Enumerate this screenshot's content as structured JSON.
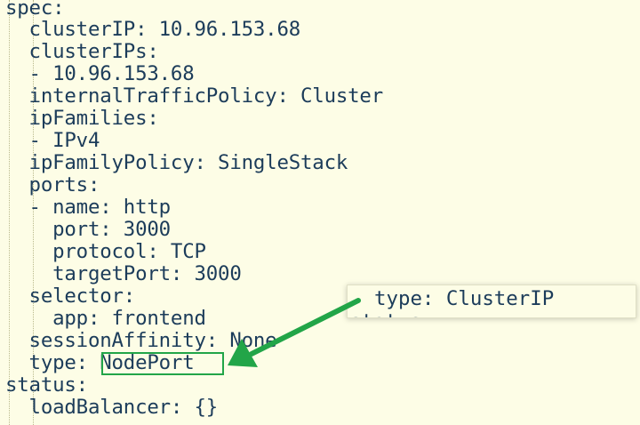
{
  "yaml": {
    "lines": [
      "spec:",
      "  clusterIP: 10.96.153.68",
      "  clusterIPs:",
      "  - 10.96.153.68",
      "  internalTrafficPolicy: Cluster",
      "  ipFamilies:",
      "  - IPv4",
      "  ipFamilyPolicy: SingleStack",
      "  ports:",
      "  - name: http",
      "    port: 3000",
      "    protocol: TCP",
      "    targetPort: 3000",
      "  selector:",
      "    app: frontend",
      "  sessionAffinity: None",
      "  type: NodePort",
      "status:",
      "  loadBalancer: {}"
    ]
  },
  "popup": {
    "line": "type: ClusterIP",
    "ghost_line": "status:"
  },
  "colors": {
    "background": "#fdfde6",
    "text": "#1c3c5a",
    "annotation": "#22a548"
  }
}
